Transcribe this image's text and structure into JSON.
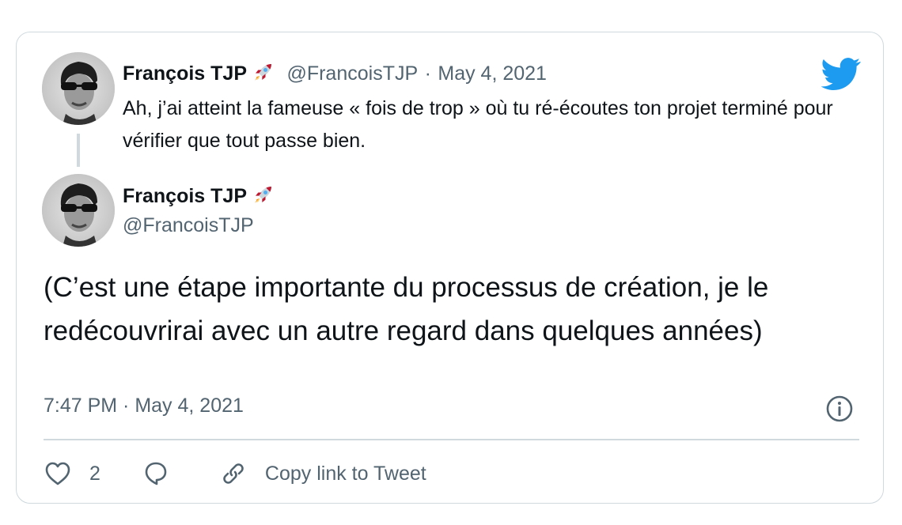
{
  "parent_tweet": {
    "display_name": "François TJP",
    "name_emoji": "rocket-emoji",
    "handle": "@FrancoisTJP",
    "separator": "·",
    "date": "May 4, 2021",
    "text": "Ah, j’ai atteint la fameuse « fois de trop » où tu ré-écoutes ton projet terminé pour vérifier que tout passe bien."
  },
  "main_tweet": {
    "display_name": "François TJP",
    "name_emoji": "rocket-emoji",
    "handle": "@FrancoisTJP",
    "text": "(C’est une étape importante du processus de création, je le redécouvrirai avec un autre regard dans quelques années)",
    "timestamp": "7:47 PM · May 4, 2021"
  },
  "actions": {
    "like_count": "2",
    "copy_link_label": "Copy link to Tweet"
  },
  "icons": {
    "brand": "twitter-bird-icon",
    "info": "info-icon",
    "like": "heart-icon",
    "reply": "reply-bubble-icon",
    "link": "link-icon"
  },
  "colors": {
    "brand_blue": "#1d9bf0",
    "secondary_text": "#536471",
    "primary_text": "#0f1419",
    "border": "#cfd9de"
  }
}
